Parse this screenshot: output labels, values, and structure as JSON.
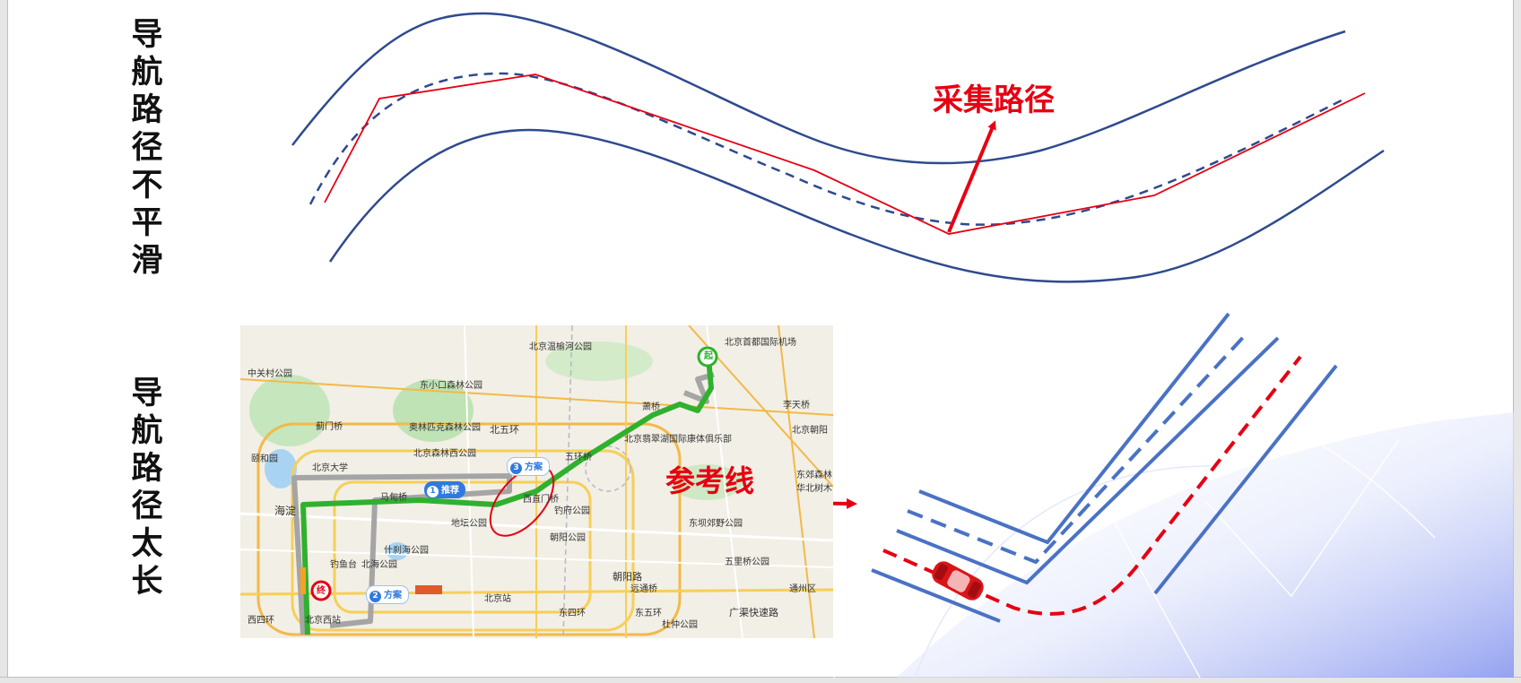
{
  "titles": {
    "top": "导航路径不平滑",
    "bottom": "导航路径太长"
  },
  "labels": {
    "collect_path": "采集路径",
    "reference_line": "参考线"
  },
  "map": {
    "places": [
      "北京首都国际机场",
      "北京温榆河公园",
      "中关村公园",
      "东小口森林公园",
      "北五环",
      "奥林匹克森林公园",
      "北京森林西公园",
      "北京大学",
      "颐和园",
      "海淀",
      "蓟门桥",
      "马甸桥",
      "西直门桥",
      "北京翡翠湖国际康体俱乐部",
      "李天桥",
      "东坝郊野公园",
      "东郊森林华北树木",
      "北京朝阳",
      "钓鱼台",
      "地坛公园",
      "什刹海公园",
      "北海公园",
      "钓府公园",
      "朝阳公园",
      "朝阳路",
      "五里桥公园",
      "通州区",
      "远通桥",
      "广渠快速路",
      "杜仲公园",
      "北京站",
      "北京西站",
      "西四环",
      "东四环",
      "东五环",
      "五环桥",
      "萧桥"
    ],
    "route_pills": [
      {
        "num": "1",
        "label": "推荐"
      },
      {
        "num": "2",
        "label": "方案"
      },
      {
        "num": "3",
        "label": "方案"
      }
    ],
    "start_marker": "起",
    "end_marker": "终"
  },
  "colors": {
    "road_blue": "#2e4a8f",
    "lane_blue": "#4a72c4",
    "red": "#e60012",
    "route_green": "#2fb12f",
    "route_gray": "#a5a5a5"
  }
}
